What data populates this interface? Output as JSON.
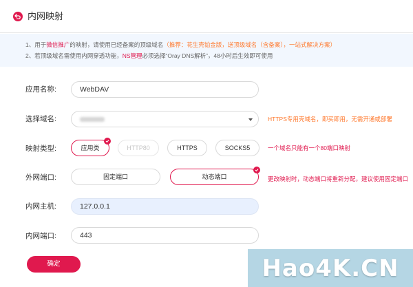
{
  "header": {
    "title": "内网映射",
    "back_icon": "back-arrow-icon"
  },
  "notice": {
    "line1_prefix": "1、用于",
    "line1_highlight": "微信推广",
    "line1_middle": "的映射，请使用已经备案的顶级域名",
    "line1_orange": "（推荐：花生壳铂金版，送顶级域名（含备案），一站式解决方案）",
    "line2_prefix": "2、若顶级域名需使用内网穿透功能，",
    "line2_highlight": "NS管理",
    "line2_suffix": "必须选择“Oray DNS解析”，48小时后生效即可使用"
  },
  "form": {
    "app_name": {
      "label": "应用名称:",
      "value": "WebDAV"
    },
    "domain": {
      "label": "选择域名:",
      "hint": "HTTPS专用壳域名，即买即用，无需开通或部署"
    },
    "map_type": {
      "label": "映射类型:",
      "options": [
        "应用类",
        "HTTP80",
        "HTTPS",
        "SOCKS5"
      ],
      "selected": "应用类",
      "hint": "一个域名只能有一个80端口映射"
    },
    "external_port": {
      "label": "外网端口:",
      "options": [
        "固定端口",
        "动态端口"
      ],
      "selected": "动态端口",
      "hint": "更改映射时，动态端口将重新分配，建议使用固定端口"
    },
    "internal_host": {
      "label": "内网主机:",
      "value": "127.0.0.1"
    },
    "internal_port": {
      "label": "内网端口:",
      "value": "443"
    }
  },
  "confirm_label": "确定",
  "watermark": "Hao4K.CN",
  "colors": {
    "accent": "#e0194e",
    "hint_orange": "#ff7a2f",
    "notice_bg": "#f2f7fe",
    "autofill_bg": "#e8f0fe"
  }
}
